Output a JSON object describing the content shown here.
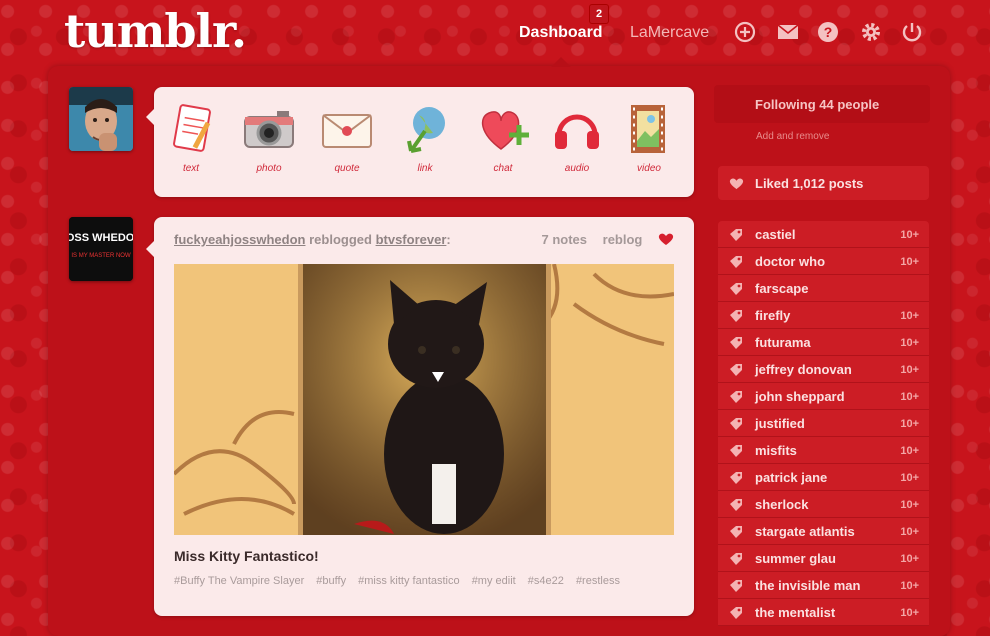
{
  "header": {
    "logo": "tumblr.",
    "nav_dashboard": "Dashboard",
    "nav_badge": "2",
    "nav_user": "LaMercave",
    "nav_icons": [
      "plus-circle-icon",
      "envelope-icon",
      "help-icon",
      "gear-icon",
      "power-icon"
    ]
  },
  "post_types": [
    {
      "label": "text",
      "icon": "notepad-icon"
    },
    {
      "label": "photo",
      "icon": "camera-icon"
    },
    {
      "label": "quote",
      "icon": "envelope-quote-icon"
    },
    {
      "label": "link",
      "icon": "globe-arrow-icon"
    },
    {
      "label": "chat",
      "icon": "heart-plus-icon"
    },
    {
      "label": "audio",
      "icon": "headphones-icon"
    },
    {
      "label": "video",
      "icon": "film-strip-icon"
    }
  ],
  "entry": {
    "author": "fuckyeahjosswhedon",
    "action": "reblogged",
    "source": "btvsforever",
    "notes": "7 notes",
    "reblog": "reblog",
    "caption": "Miss Kitty Fantastico!",
    "tags": [
      "#Buffy The Vampire Slayer",
      "#buffy",
      "#miss kitty fantastico",
      "#my ediit",
      "#s4e22",
      "#restless"
    ],
    "avatar2_text": "JOSS WHEDON",
    "avatar2_sub": "IS MY MASTER NOW"
  },
  "sidebar": {
    "following": "Following 44 people",
    "add_remove": "Add and remove",
    "liked": "Liked 1,012 posts",
    "tags": [
      {
        "name": "castiel",
        "count": "10+"
      },
      {
        "name": "doctor who",
        "count": "10+"
      },
      {
        "name": "farscape",
        "count": ""
      },
      {
        "name": "firefly",
        "count": "10+"
      },
      {
        "name": "futurama",
        "count": "10+"
      },
      {
        "name": "jeffrey donovan",
        "count": "10+"
      },
      {
        "name": "john sheppard",
        "count": "10+"
      },
      {
        "name": "justified",
        "count": "10+"
      },
      {
        "name": "misfits",
        "count": "10+"
      },
      {
        "name": "patrick jane",
        "count": "10+"
      },
      {
        "name": "sherlock",
        "count": "10+"
      },
      {
        "name": "stargate atlantis",
        "count": "10+"
      },
      {
        "name": "summer glau",
        "count": "10+"
      },
      {
        "name": "the invisible man",
        "count": "10+"
      },
      {
        "name": "the mentalist",
        "count": "10+"
      }
    ]
  },
  "colors": {
    "accent": "#c8141c",
    "panel": "#bd1119",
    "card": "#fbeaea",
    "tag_row": "#cc1d25"
  }
}
